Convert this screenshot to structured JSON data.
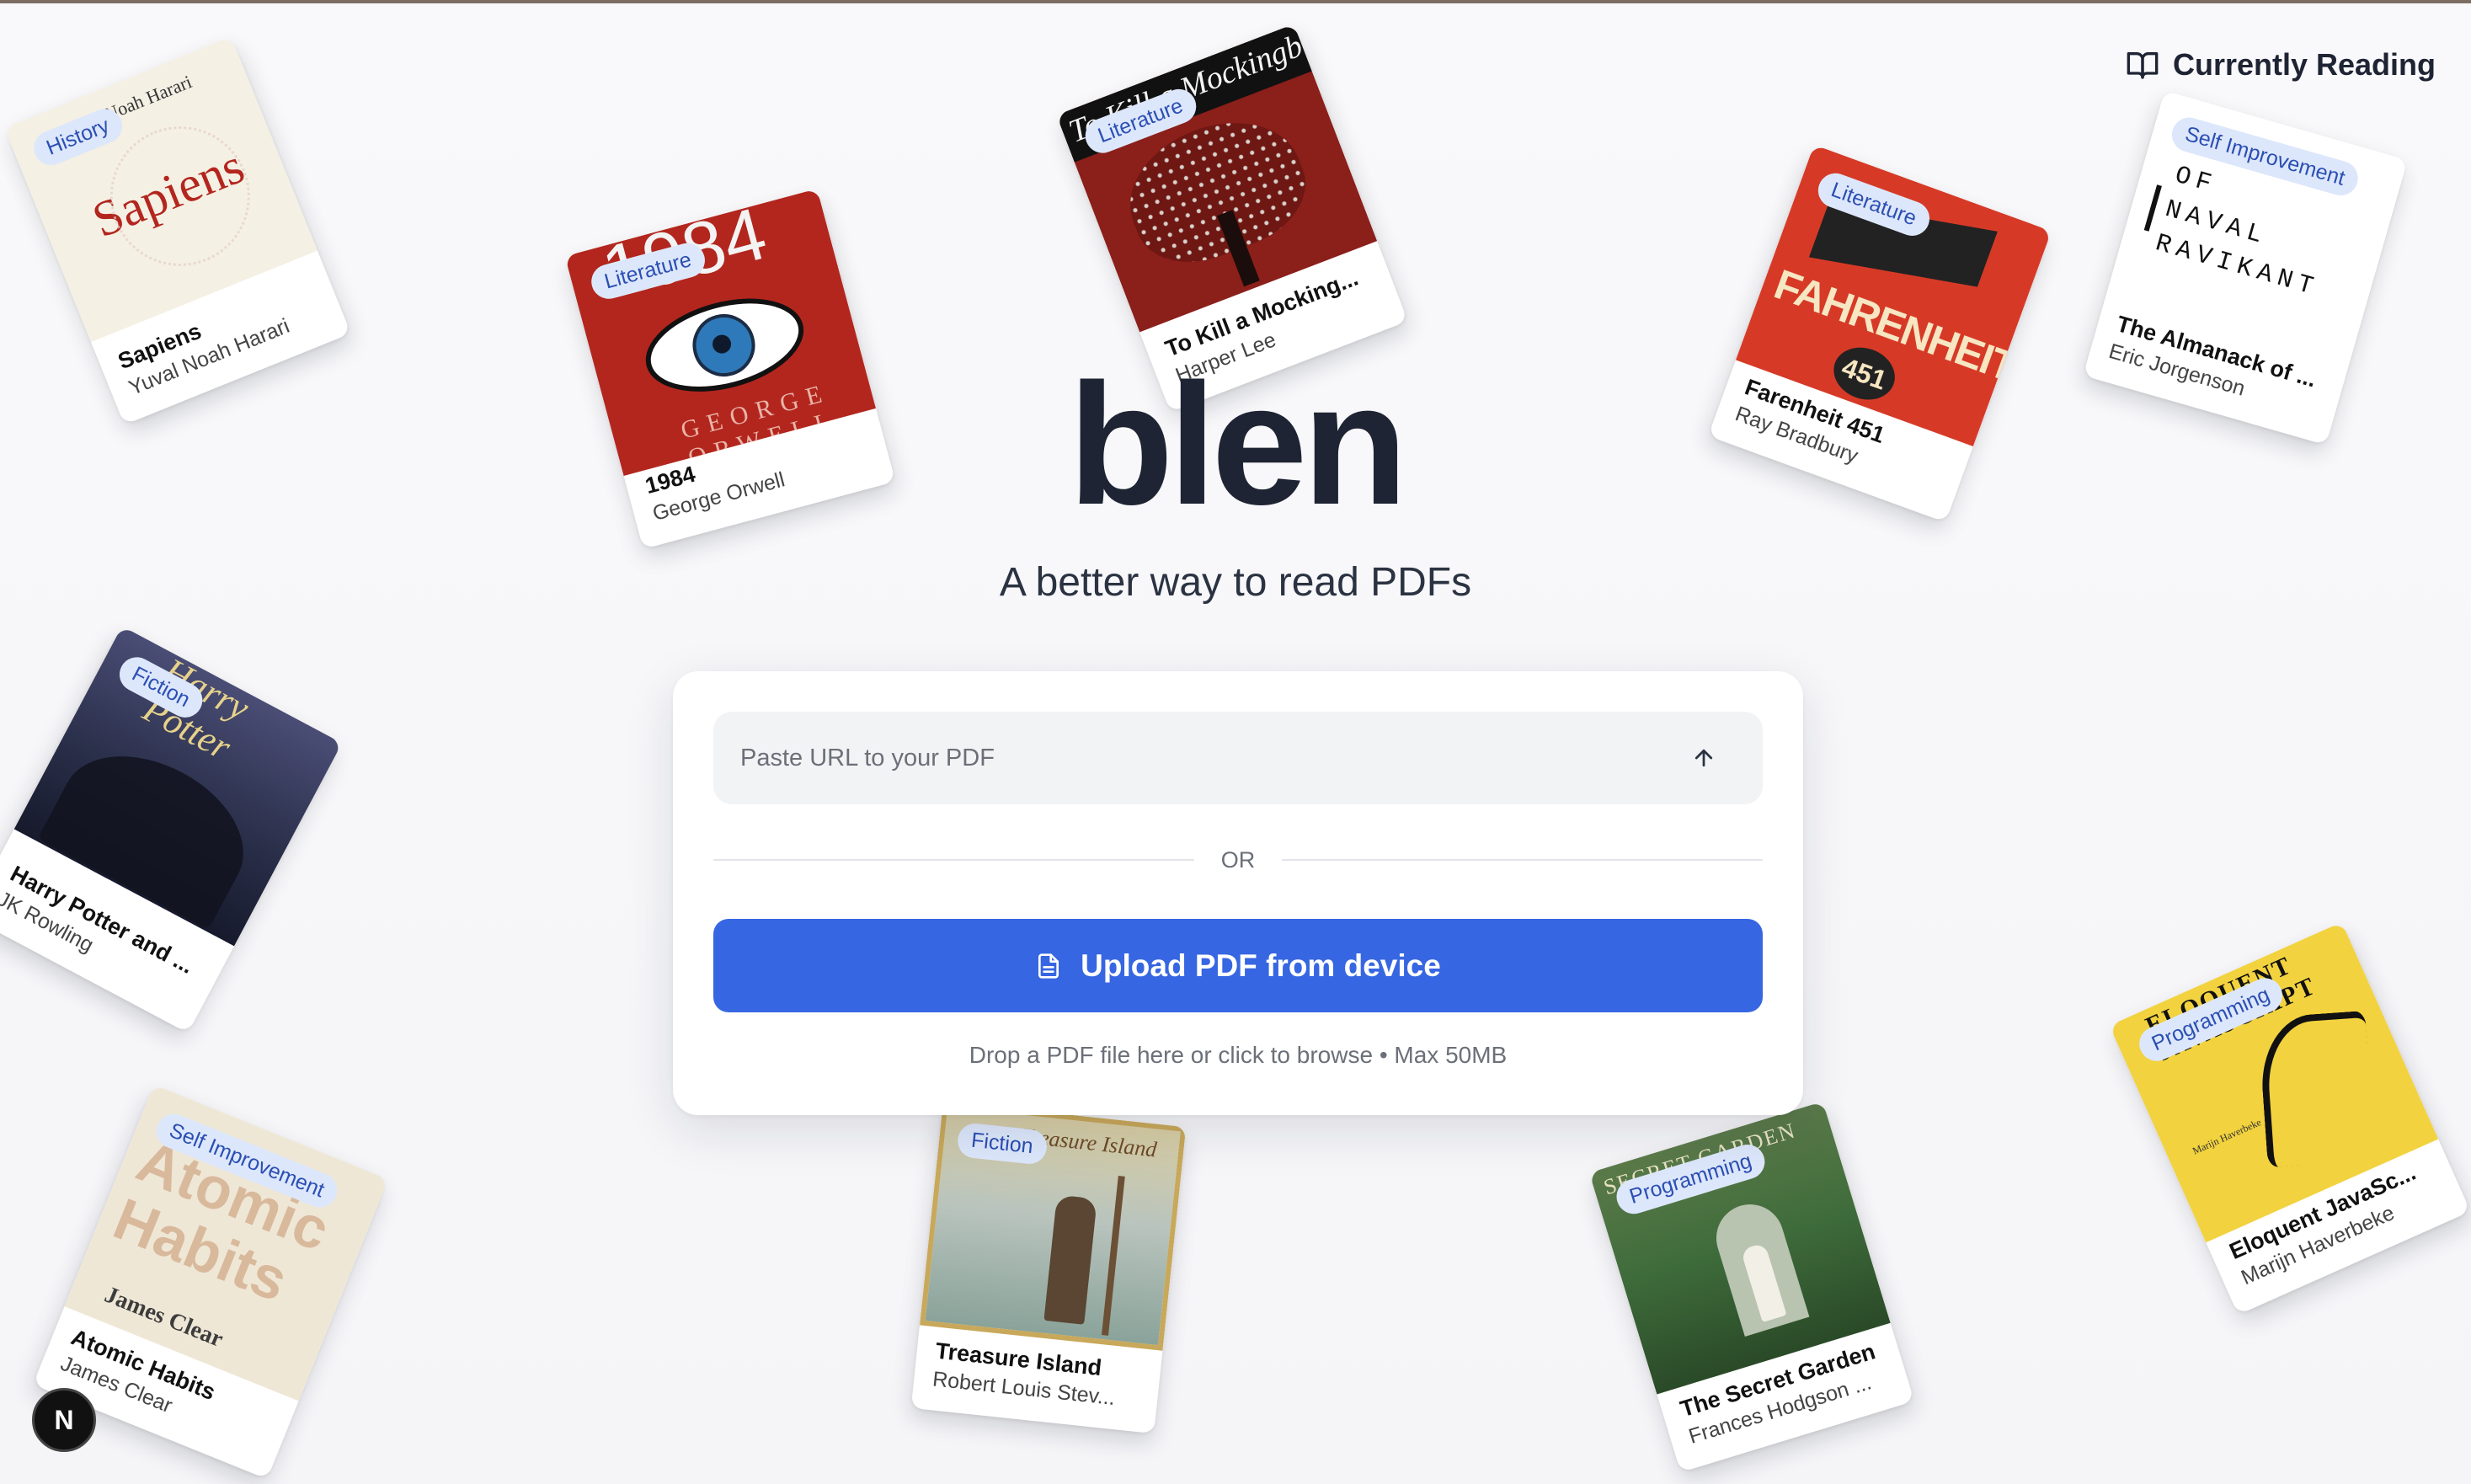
{
  "nav": {
    "currently_reading_label": "Currently Reading"
  },
  "hero": {
    "logo": "blen",
    "tagline": "A better way to read PDFs"
  },
  "upload": {
    "url_placeholder": "Paste URL to your PDF",
    "divider_text": "OR",
    "upload_button_label": "Upload PDF from device",
    "hint": "Drop a PDF file here or click to browse • Max 50MB"
  },
  "books": [
    {
      "title": "Sapiens",
      "author": "Yuval Noah Harari",
      "tag": "History",
      "cover_title": "Sapiens",
      "cover_author": "Yuval Noah Harari",
      "cover_color": "#f5f0e4"
    },
    {
      "title": "1984",
      "author": "George Orwell",
      "tag": "Literature",
      "cover_title": "1984",
      "cover_author": "GEORGE ORWELL",
      "cover_color": "#b3261e"
    },
    {
      "title": "To Kill a Mocking...",
      "author": "Harper Lee",
      "tag": "Literature",
      "cover_title": "To Kill a Mockingbird",
      "cover_author": "HARPER LEE",
      "cover_color": "#8b1f1a"
    },
    {
      "title": "Farenheit 451",
      "author": "Ray Bradbury",
      "tag": "Literature",
      "cover_title": "FAHRENHEIT",
      "cover_author": "451",
      "cover_color": "#d63a27"
    },
    {
      "title": "The Almanack of ...",
      "author": "Eric Jorgenson",
      "tag": "Self Improvement",
      "cover_title": "ALMANACK OF NAVAL RAVIKANT",
      "cover_author": "",
      "cover_color": "#ffffff"
    },
    {
      "title": "Harry Potter and ...",
      "author": "JK Rowling",
      "tag": "Fiction",
      "cover_title": "Harry Potter",
      "cover_author": "",
      "cover_color": "#2a2f4a"
    },
    {
      "title": "Atomic Habits",
      "author": "James Clear",
      "tag": "Self Improvement",
      "cover_title": "Atomic Habits",
      "cover_author": "James Clear",
      "cover_color": "#efe7d6"
    },
    {
      "title": "Treasure Island",
      "author": "Robert Louis Stev...",
      "tag": "Fiction",
      "cover_title": "Treasure Island",
      "cover_author": "",
      "cover_color": "#c8a85a"
    },
    {
      "title": "The Secret Garden",
      "author": "Frances Hodgson ...",
      "tag": "Programming",
      "cover_title": "SECRET GARDEN",
      "cover_author": "",
      "cover_color": "#3e6b3a"
    },
    {
      "title": "Eloquent JavaSc...",
      "author": "Marijn Haverbeke",
      "tag": "Programming",
      "cover_title": "ELOQUENT JAVASCRIPT",
      "cover_author": "Marijn Haverbeke",
      "cover_color": "#f2d23e"
    }
  ],
  "badge": {
    "label": "N"
  },
  "colors": {
    "accent": "#3766e2",
    "text": "#1e2433",
    "tag_bg": "#dde7fb",
    "tag_text": "#2b4fb3"
  }
}
